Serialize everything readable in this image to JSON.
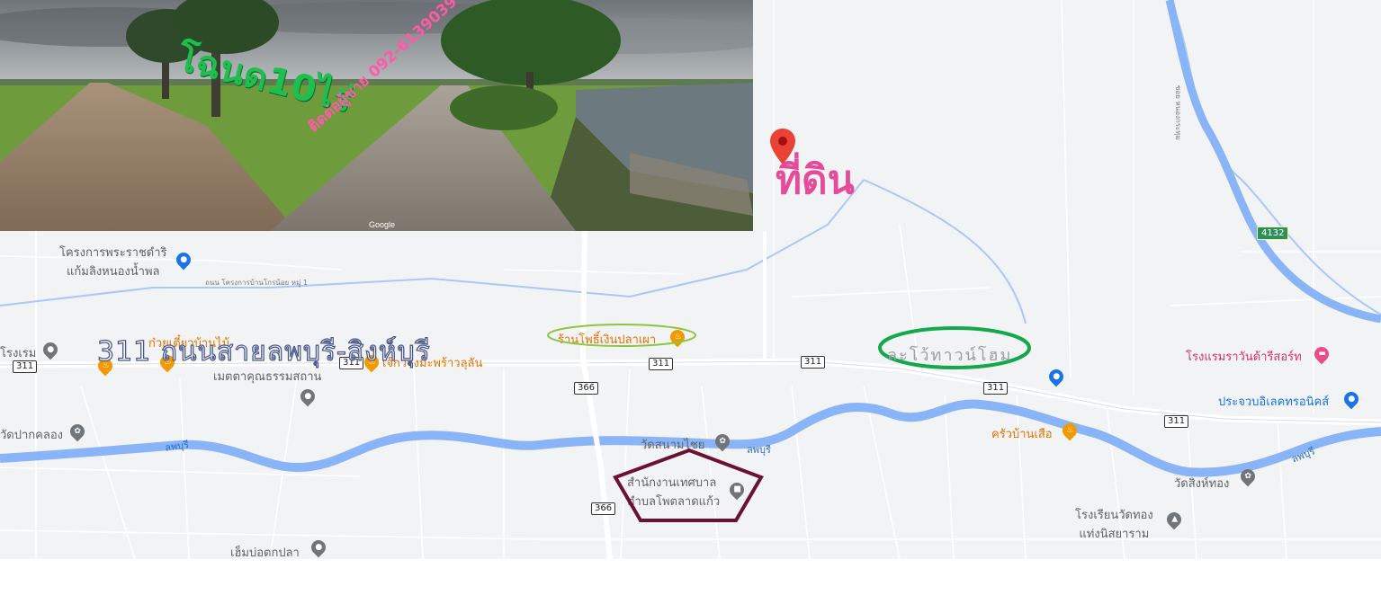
{
  "photo": {
    "zone_text": "โฉนด10ไร่",
    "contact_text": "ติดต่อผู้ขาย 092-6139039",
    "watermark": "Google"
  },
  "overlays": {
    "land_marker_text": "ที่ดิน",
    "road_caption": "311 ถนนสายลพบุรี-สิงห์บุรี",
    "circled_place": "ละโว้ทาวน์โฮม"
  },
  "map": {
    "pois": {
      "royal_project": "โครงการพระราชดำริ\nแก้มลิงหนองน้ำพล",
      "noodle_shop": "ก๋วยเตี๋ยวบ้านไม้",
      "metta_foundation": "เมตตาคุณธรรมสถาน",
      "restaurant_fish": "ร้านโพธิ์เงินปลาเผา",
      "restaurant_chicken": "เจ๊กวางมะพร้าวลุลัน",
      "wat_paklong": "วัดปากคลอง",
      "wat_sanamchai": "วัดสนามไชย",
      "municipal_office": "สำนักงานเทศบาล\nตำบลโพตลาดแก้ว",
      "krua_ban_suea": "ครัวบ้านเสือ",
      "hotel": "โรงแรมราวันด้ารีสอร์ท",
      "electronics": "ประจวบอิเลคทรอนิคส์",
      "wat_singthong": "วัดสิงห์ทอง",
      "school": "โรงเรียนวัดทอง\nแท่งนิสยาราม",
      "fish_pond": "เฮ็มบ่อตกปลา",
      "left_cut": "โรงเรม"
    },
    "road_labels": {
      "village_road": "ถนน โครงการบ้านโกรน้อย หมู่ 1",
      "side_road": "ซอย หนองกระทุม"
    },
    "river_labels": [
      "ลพบุรี",
      "ลพบุรี",
      "ลพบุรี"
    ],
    "shields": [
      "311",
      "311",
      "311",
      "311",
      "311",
      "366",
      "366",
      "311"
    ],
    "shield_green": "4132"
  },
  "colors": {
    "map_bg": "#f2f3f5",
    "river": "#8ab4f8",
    "road": "#ffffff",
    "zone_text": "#1fbf4f",
    "contact_text": "#e0408a",
    "land_text": "#e64b9a",
    "ellipse_green": "#13a84b",
    "pentagon": "#6b1230"
  },
  "icons": {
    "land_pin": "map-pin-icon",
    "poi": "poi-marker-icon"
  }
}
